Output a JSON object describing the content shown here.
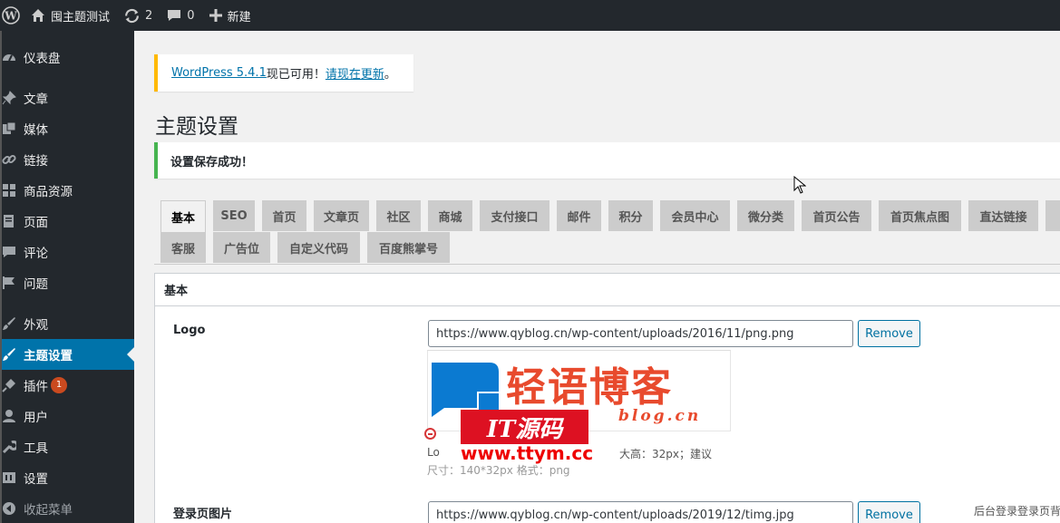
{
  "adminbar": {
    "site_name": "囤主题测试",
    "updates_count": "2",
    "comments_count": "0",
    "new_label": "新建"
  },
  "sidebar": {
    "items": [
      {
        "label": "仪表盘",
        "icon": "dashboard-icon"
      },
      {
        "label": "文章",
        "icon": "pin-icon"
      },
      {
        "label": "媒体",
        "icon": "media-icon"
      },
      {
        "label": "链接",
        "icon": "link-icon"
      },
      {
        "label": "商品资源",
        "icon": "grid-icon"
      },
      {
        "label": "页面",
        "icon": "page-icon"
      },
      {
        "label": "评论",
        "icon": "comment-icon"
      },
      {
        "label": "问题",
        "icon": "flag-icon"
      },
      {
        "label": "外观",
        "icon": "brush-icon"
      },
      {
        "label": "主题设置",
        "icon": "settings-brush-icon"
      },
      {
        "label": "插件",
        "icon": "plugin-icon",
        "badge": "1"
      },
      {
        "label": "用户",
        "icon": "user-icon"
      },
      {
        "label": "工具",
        "icon": "wrench-icon"
      },
      {
        "label": "设置",
        "icon": "settings-icon"
      },
      {
        "label": "收起菜单",
        "icon": "collapse-icon"
      }
    ]
  },
  "update_nag": {
    "link1": "WordPress 5.4.1",
    "text": "现已可用！",
    "link2": "请现在更新",
    "end": "。"
  },
  "page_title": "主题设置",
  "success_notice": "设置保存成功！",
  "tabs": {
    "row1": [
      "基本",
      "SEO",
      "首页",
      "文章页",
      "社区",
      "商城",
      "支付接口",
      "邮件",
      "积分",
      "会员中心",
      "微分类",
      "首页公告",
      "首页焦点图",
      "直达链接"
    ],
    "row2": [
      "客服",
      "广告位",
      "自定义代码",
      "百度熊掌号"
    ],
    "active": "基本"
  },
  "panel": {
    "title": "基本",
    "logo": {
      "label": "Logo",
      "value": "https://www.qyblog.cn/wp-content/uploads/2016/11/png.png",
      "remove": "Remove",
      "preview_title": "轻语博客",
      "preview_sub": "blog.cn",
      "desc_line1_start": "Lo",
      "desc_line1_end": "大高：32px；建议",
      "desc_line2": "尺寸：140*32px 格式：png"
    },
    "login_image": {
      "label": "登录页图片",
      "value": "https://www.qyblog.cn/wp-content/uploads/2019/12/timg.jpg",
      "remove": "Remove",
      "note": "后台登录登录页背"
    }
  },
  "watermark": {
    "brand": "IT源码",
    "url": "www.ttym.cc"
  },
  "colors": {
    "admin_dark": "#23282d",
    "accent_blue": "#0073aa",
    "success_green": "#46b450",
    "warning_yellow": "#ffb900",
    "logo_orange": "#e84a2d",
    "logo_blue": "#0b7ad1"
  }
}
